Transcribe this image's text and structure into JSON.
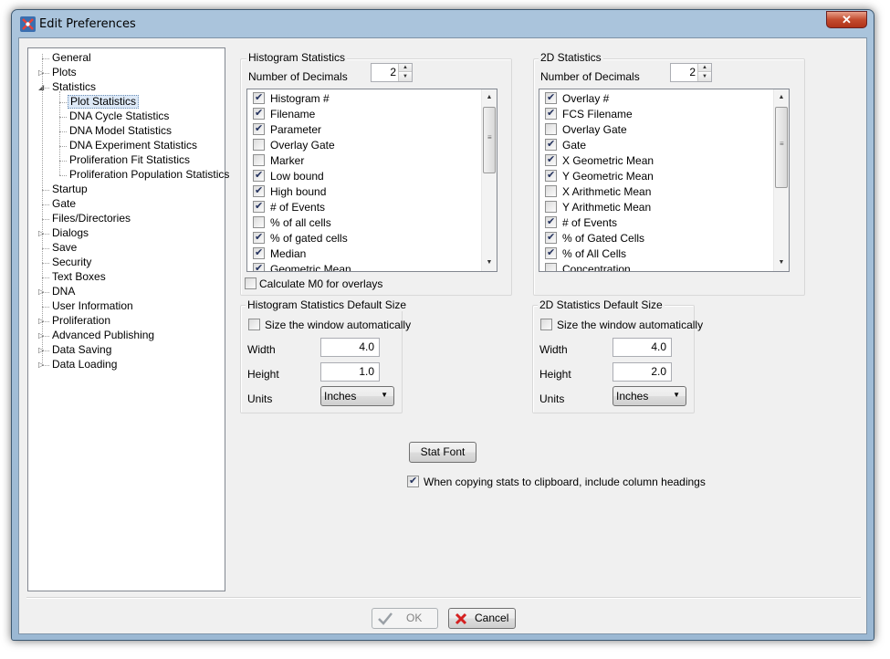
{
  "window": {
    "title": "Edit Preferences",
    "close_glyph": "✕"
  },
  "tree": {
    "items": [
      {
        "label": "General",
        "expander": ""
      },
      {
        "label": "Plots",
        "expander": "▷"
      },
      {
        "label": "Statistics",
        "expander": "◢"
      },
      {
        "label": "Plot Statistics",
        "expander": ""
      },
      {
        "label": "DNA Cycle Statistics",
        "expander": ""
      },
      {
        "label": "DNA Model Statistics",
        "expander": ""
      },
      {
        "label": "DNA Experiment Statistics",
        "expander": ""
      },
      {
        "label": "Proliferation Fit Statistics",
        "expander": ""
      },
      {
        "label": "Proliferation Population Statistics",
        "expander": ""
      },
      {
        "label": "Startup",
        "expander": ""
      },
      {
        "label": "Gate",
        "expander": ""
      },
      {
        "label": "Files/Directories",
        "expander": ""
      },
      {
        "label": "Dialogs",
        "expander": "▷"
      },
      {
        "label": "Save",
        "expander": ""
      },
      {
        "label": "Security",
        "expander": ""
      },
      {
        "label": "Text Boxes",
        "expander": ""
      },
      {
        "label": "DNA",
        "expander": "▷"
      },
      {
        "label": "User Information",
        "expander": ""
      },
      {
        "label": "Proliferation",
        "expander": "▷"
      },
      {
        "label": "Advanced Publishing",
        "expander": "▷"
      },
      {
        "label": "Data Saving",
        "expander": "▷"
      },
      {
        "label": "Data Loading",
        "expander": "▷"
      }
    ],
    "selected": "Plot Statistics"
  },
  "histogram": {
    "title": "Histogram Statistics",
    "decimals_label": "Number of Decimals",
    "decimals_value": "2",
    "items": [
      {
        "label": "Histogram #",
        "checked": true
      },
      {
        "label": "Filename",
        "checked": true
      },
      {
        "label": "Parameter",
        "checked": true
      },
      {
        "label": "Overlay Gate",
        "checked": false
      },
      {
        "label": "Marker",
        "checked": false
      },
      {
        "label": "Low bound",
        "checked": true
      },
      {
        "label": "High bound",
        "checked": true
      },
      {
        "label": "# of Events",
        "checked": true
      },
      {
        "label": "% of all cells",
        "checked": false
      },
      {
        "label": "% of gated cells",
        "checked": true
      },
      {
        "label": "Median",
        "checked": true
      },
      {
        "label": "Geometric Mean",
        "checked": true
      }
    ],
    "calc_m0_label": "Calculate M0 for overlays",
    "calc_m0_checked": false
  },
  "stats2d": {
    "title": "2D Statistics",
    "decimals_label": "Number of Decimals",
    "decimals_value": "2",
    "items": [
      {
        "label": "Overlay #",
        "checked": true
      },
      {
        "label": "FCS Filename",
        "checked": true
      },
      {
        "label": "Overlay Gate",
        "checked": false
      },
      {
        "label": "Gate",
        "checked": true
      },
      {
        "label": "X Geometric Mean",
        "checked": true
      },
      {
        "label": "Y Geometric Mean",
        "checked": true
      },
      {
        "label": "X Arithmetic Mean",
        "checked": false
      },
      {
        "label": "Y Arithmetic Mean",
        "checked": false
      },
      {
        "label": "# of Events",
        "checked": true
      },
      {
        "label": "% of Gated Cells",
        "checked": true
      },
      {
        "label": "% of All Cells",
        "checked": true
      },
      {
        "label": "Concentration",
        "checked": false
      }
    ]
  },
  "hist_size": {
    "title": "Histogram Statistics Default Size",
    "auto_label": "Size the window automatically",
    "auto_checked": false,
    "width_label": "Width",
    "width_value": "4.0",
    "height_label": "Height",
    "height_value": "1.0",
    "units_label": "Units",
    "units_value": "Inches"
  },
  "size2d": {
    "title": "2D Statistics Default Size",
    "auto_label": "Size the window automatically",
    "auto_checked": false,
    "width_label": "Width",
    "width_value": "4.0",
    "height_label": "Height",
    "height_value": "2.0",
    "units_label": "Units",
    "units_value": "Inches"
  },
  "stat_font_label": "Stat Font",
  "copy_headings_label": "When copying stats to clipboard, include column headings",
  "copy_headings_checked": true,
  "footer": {
    "ok_label": "OK",
    "cancel_label": "Cancel"
  },
  "colors": {
    "title_bar": "#9bb8d3",
    "cancel_icon": "#d42020",
    "ok_icon": "#9aa0a6"
  }
}
